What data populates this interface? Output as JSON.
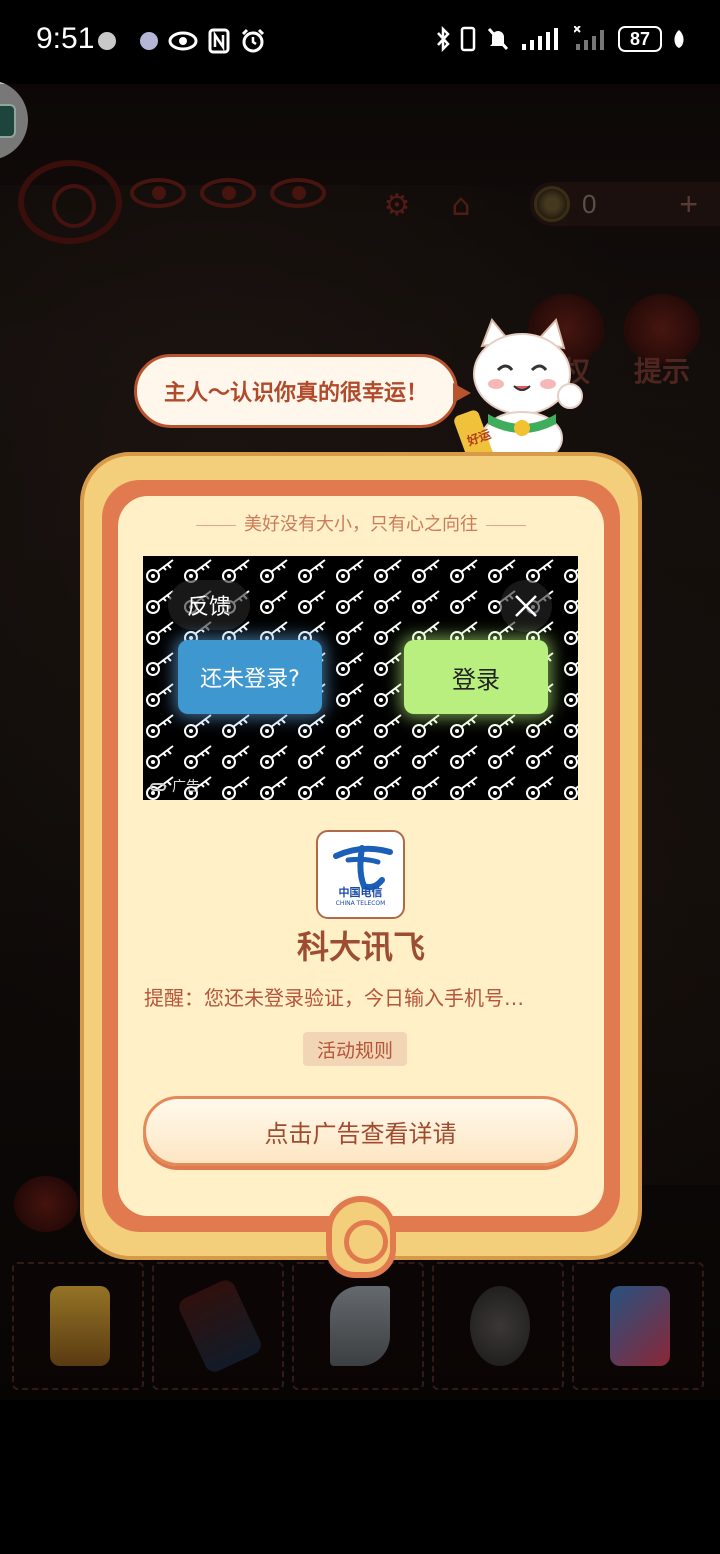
{
  "status_bar": {
    "time": "9:51",
    "battery": "87",
    "left_icons": [
      "app-icon",
      "app-icon",
      "eye-icon",
      "nfc-icon",
      "alarm-icon"
    ],
    "right_icons": [
      "bluetooth-icon",
      "vibrate-icon",
      "mute-icon",
      "signal-icon",
      "signal-icon",
      "battery-icon",
      "leaf-icon"
    ]
  },
  "game": {
    "coins": "0",
    "coin_plus": "+",
    "tool_tv_label": "权",
    "tool_hint_label": "提示"
  },
  "bubble": {
    "text": "主人～认识你真的很幸运！",
    "cat_tag": "好运"
  },
  "dialog": {
    "motto": "美好没有大小，只有心之向往",
    "ad": {
      "feedback": "反馈",
      "not_logged_in": "还未登录?",
      "login": "登录",
      "ad_tag": "广告"
    },
    "advertiser": {
      "logo_text": "中国电信",
      "logo_subtext": "CHINA TELECOM",
      "name": "科大讯飞",
      "description": "提醒：您还未登录验证，今日输入手机号…",
      "rules": "活动规则"
    },
    "cta": "点击广告查看详请"
  },
  "colors": {
    "dialog_outer": "#f3ce7b",
    "dialog_mid": "#e27a4f",
    "dialog_inner": "#fff0c7",
    "accent_text": "#9c4d32",
    "ad_blue": "#3f97d0",
    "ad_green": "#b8ef7e"
  }
}
